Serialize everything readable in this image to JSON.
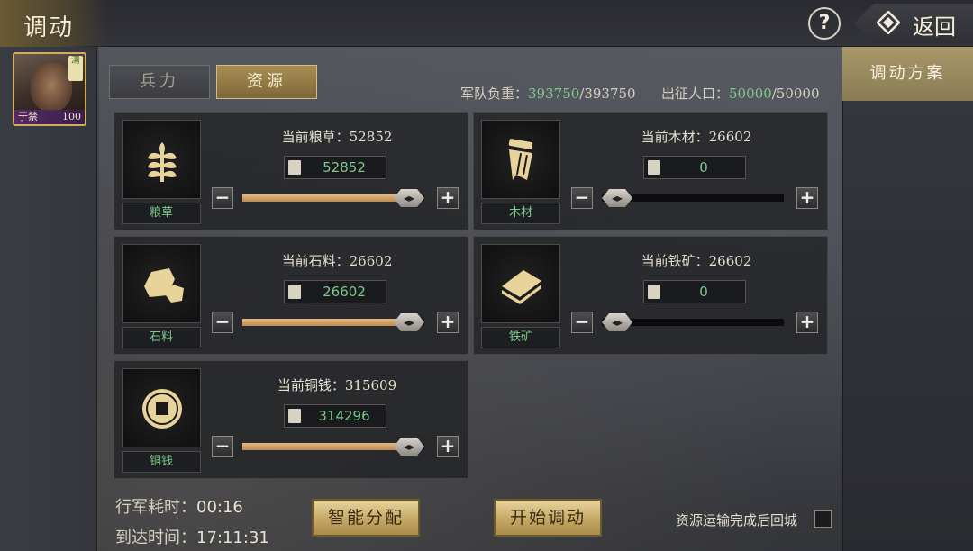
{
  "header": {
    "title": "调动",
    "help": "?",
    "back_label": "返回"
  },
  "hero": {
    "name": "于禁",
    "level": "100",
    "badge": "清"
  },
  "tabs": [
    {
      "label": "兵力",
      "active": false
    },
    {
      "label": "资源",
      "active": true
    }
  ],
  "stats": {
    "load_label": "军队负重：",
    "load_current": "393750",
    "load_max": "/393750",
    "pop_label": "出征人口：",
    "pop_current": "50000",
    "pop_max": "/50000"
  },
  "resources": [
    {
      "name": "粮草",
      "icon": "grain-icon",
      "current_label": "当前粮草：52852",
      "input_value": "52852",
      "slider_fraction": 1.0
    },
    {
      "name": "木材",
      "icon": "wood-icon",
      "current_label": "当前木材：26602",
      "input_value": "0",
      "slider_fraction": 0.0
    },
    {
      "name": "石料",
      "icon": "stone-icon",
      "current_label": "当前石料：26602",
      "input_value": "26602",
      "slider_fraction": 1.0
    },
    {
      "name": "铁矿",
      "icon": "iron-icon",
      "current_label": "当前铁矿：26602",
      "input_value": "0",
      "slider_fraction": 0.0
    },
    {
      "name": "铜钱",
      "icon": "coin-icon",
      "current_label": "当前铜钱：315609",
      "input_value": "314296",
      "slider_fraction": 1.0
    }
  ],
  "footer": {
    "march_label": "行军耗时：",
    "march_time": "00:16",
    "arrive_label": "到达时间：",
    "arrive_time": "17:11:31",
    "auto_button": "智能分配",
    "start_button": "开始调动",
    "return_label": "资源运输完成后回城",
    "return_checked": false
  },
  "side": {
    "plan_label": "调动方案"
  },
  "colors": {
    "accent_green": "#7ec88a",
    "gold": "#c6a865",
    "slider_fill": "#d9a86e"
  }
}
